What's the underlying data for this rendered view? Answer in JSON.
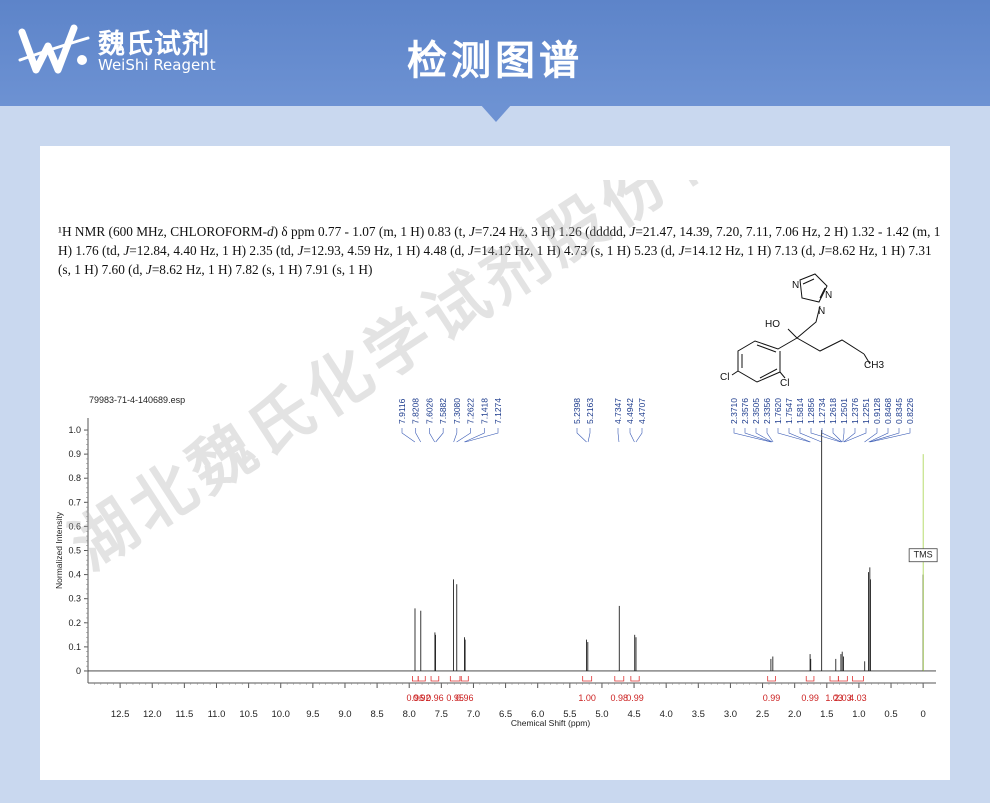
{
  "header": {
    "brand_cn": "魏氏试剂",
    "brand_en": "WeiShi Reagent",
    "title": "检测图谱",
    "logo_icon": "ws-logo-icon"
  },
  "description": {
    "parts": [
      {
        "t": "¹H NMR (600 MHz, CHLOROFORM-"
      },
      {
        "t": "d",
        "i": true
      },
      {
        "t": ") δ ppm 0.77 - 1.07 (m, 1 H) 0.83 (t, "
      },
      {
        "t": "J",
        "i": true
      },
      {
        "t": "=7.24 Hz, 3 H) 1.26 (ddddd, "
      },
      {
        "t": "J",
        "i": true
      },
      {
        "t": "=21.47, 14.39, 7.20, 7.11, 7.06 Hz, 2 H) 1.32 - 1.42 (m, 1 H) 1.76 (td, "
      },
      {
        "t": "J",
        "i": true
      },
      {
        "t": "=12.84, 4.40 Hz, 1 H) 2.35 (td, "
      },
      {
        "t": "J",
        "i": true
      },
      {
        "t": "=12.93, 4.59 Hz, 1 H) 4.48 (d, "
      },
      {
        "t": "J",
        "i": true
      },
      {
        "t": "=14.12 Hz, 1 H) 4.73 (s, 1 H) 5.23 (d, "
      },
      {
        "t": "J",
        "i": true
      },
      {
        "t": "=14.12 Hz, 1 H) 7.13 (d, "
      },
      {
        "t": "J",
        "i": true
      },
      {
        "t": "=8.62 Hz, 1 H) 7.31 (s, 1 H) 7.60 (d, "
      },
      {
        "t": "J",
        "i": true
      },
      {
        "t": "=8.62 Hz, 1 H) 7.82 (s, 1 H) 7.91 (s, 1 H)"
      }
    ]
  },
  "molecule": {
    "labels": [
      "N",
      "N",
      "N",
      "HO",
      "Cl",
      "Cl",
      "CH3"
    ]
  },
  "watermark": "湖北魏氏化学试剂股份有限公司",
  "chart_data": {
    "type": "line",
    "filename": "79983-71-4-140689.esp",
    "xlabel": "Chemical Shift (ppm)",
    "ylabel": "Normalized Intensity",
    "xlim": [
      13,
      -0.2
    ],
    "ylim": [
      -0.05,
      1.05
    ],
    "x_ticks": [
      12.5,
      12.0,
      11.5,
      11.0,
      10.5,
      10.0,
      9.5,
      9.0,
      8.5,
      8.0,
      7.5,
      7.0,
      6.5,
      6.0,
      5.5,
      5.0,
      4.5,
      4.0,
      3.5,
      3.0,
      2.5,
      2.0,
      1.5,
      1.0,
      0.5,
      0
    ],
    "x_tick_labels": [
      "12.5",
      "12.0",
      "11.5",
      "11.0",
      "10.5",
      "10.0",
      "9.5",
      "9.0",
      "8.5",
      "8.0",
      "7.5",
      "7.0",
      "6.5",
      "6.0",
      "5.5",
      "5.0",
      "4.5",
      "4.0",
      "3.5",
      "3.0",
      "2.5",
      "2.0",
      "1.5",
      "1.0",
      "0.5",
      "0"
    ],
    "y_ticks": [
      0,
      0.1,
      0.2,
      0.3,
      0.4,
      0.5,
      0.6,
      0.7,
      0.8,
      0.9,
      1.0
    ],
    "y_tick_labels": [
      "0",
      "0.1",
      "0.2",
      "0.3",
      "0.4",
      "0.5",
      "0.6",
      "0.7",
      "0.8",
      "0.9",
      "1.0"
    ],
    "peak_label_groups": [
      {
        "labels": [
          "7.9116",
          "7.8208",
          "7.6026",
          "7.5882",
          "7.3080",
          "7.2622",
          "7.1418",
          "7.1274"
        ]
      },
      {
        "labels": [
          "5.2398",
          "5.2163"
        ]
      },
      {
        "labels": [
          "4.7347",
          "4.4942",
          "4.4707"
        ]
      },
      {
        "labels": [
          "2.3710",
          "2.3576",
          "2.3505",
          "2.3356",
          "1.7620",
          "1.7547",
          "1.5814",
          "1.2856",
          "1.2734",
          "1.2618",
          "1.2501",
          "1.2376",
          "1.2251",
          "0.9128",
          "0.8468",
          "0.8345",
          "0.8226"
        ]
      }
    ],
    "peaks": [
      {
        "x": 7.91,
        "y": 0.26
      },
      {
        "x": 7.82,
        "y": 0.25
      },
      {
        "x": 7.6,
        "y": 0.16
      },
      {
        "x": 7.59,
        "y": 0.15
      },
      {
        "x": 7.31,
        "y": 0.38
      },
      {
        "x": 7.26,
        "y": 0.36
      },
      {
        "x": 7.14,
        "y": 0.14
      },
      {
        "x": 7.13,
        "y": 0.13
      },
      {
        "x": 5.24,
        "y": 0.13
      },
      {
        "x": 5.22,
        "y": 0.12
      },
      {
        "x": 4.73,
        "y": 0.27
      },
      {
        "x": 4.49,
        "y": 0.15
      },
      {
        "x": 4.47,
        "y": 0.14
      },
      {
        "x": 2.37,
        "y": 0.05
      },
      {
        "x": 2.34,
        "y": 0.06
      },
      {
        "x": 1.76,
        "y": 0.07
      },
      {
        "x": 1.75,
        "y": 0.05
      },
      {
        "x": 1.58,
        "y": 1.0
      },
      {
        "x": 1.36,
        "y": 0.05
      },
      {
        "x": 1.28,
        "y": 0.07
      },
      {
        "x": 1.26,
        "y": 0.08
      },
      {
        "x": 1.24,
        "y": 0.06
      },
      {
        "x": 0.91,
        "y": 0.04
      },
      {
        "x": 0.85,
        "y": 0.41
      },
      {
        "x": 0.83,
        "y": 0.43
      },
      {
        "x": 0.82,
        "y": 0.38
      },
      {
        "x": 0.0,
        "y": 0.4
      }
    ],
    "integrals": [
      {
        "from": 7.95,
        "to": 7.86,
        "label": "0.96"
      },
      {
        "from": 7.86,
        "to": 7.75,
        "label": "0.92"
      },
      {
        "from": 7.66,
        "to": 7.54,
        "label": "0.96"
      },
      {
        "from": 7.36,
        "to": 7.21,
        "label": "0.95"
      },
      {
        "from": 7.19,
        "to": 7.08,
        "label": "0.96"
      },
      {
        "from": 5.3,
        "to": 5.16,
        "label": "1.00"
      },
      {
        "from": 4.8,
        "to": 4.66,
        "label": "0.98"
      },
      {
        "from": 4.55,
        "to": 4.42,
        "label": "0.99"
      },
      {
        "from": 2.42,
        "to": 2.3,
        "label": "0.99"
      },
      {
        "from": 1.82,
        "to": 1.7,
        "label": "0.99"
      },
      {
        "from": 1.45,
        "to": 1.32,
        "label": "1.03"
      },
      {
        "from": 1.32,
        "to": 1.18,
        "label": "2.03"
      },
      {
        "from": 1.1,
        "to": 0.93,
        "label": "4.03"
      }
    ],
    "annotations": [
      {
        "x": 0.0,
        "text": "TMS"
      }
    ]
  }
}
